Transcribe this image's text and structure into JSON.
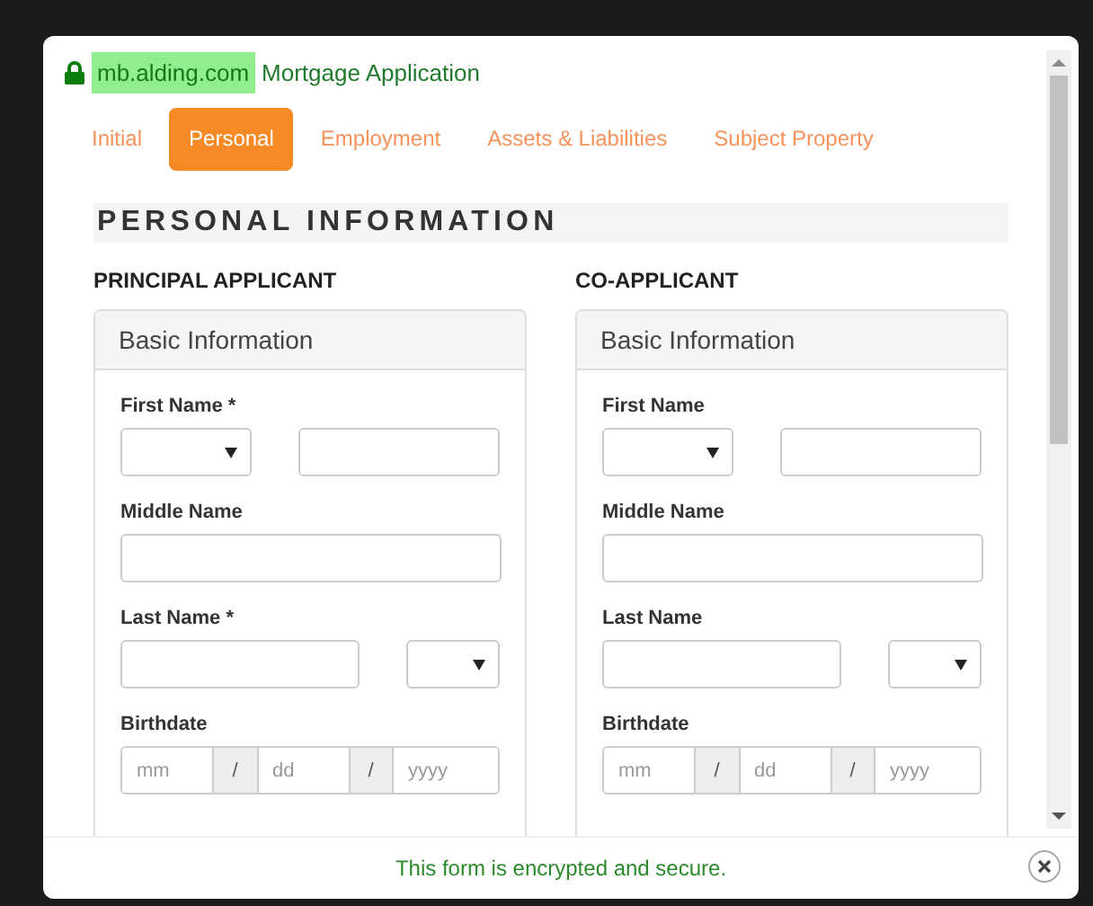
{
  "header": {
    "domain": "mb.alding.com",
    "title": "Mortgage Application"
  },
  "tabs": [
    {
      "label": "Initial",
      "selected": false
    },
    {
      "label": "Personal",
      "selected": true
    },
    {
      "label": "Employment",
      "selected": false
    },
    {
      "label": "Assets & Liabilities",
      "selected": false
    },
    {
      "label": "Subject Property",
      "selected": false
    }
  ],
  "section_title": "PERSONAL INFORMATION",
  "applicants": [
    {
      "heading": "PRINCIPAL APPLICANT",
      "panel_title": "Basic Information",
      "fields": [
        {
          "kind": "prefix-name",
          "label": "First Name *"
        },
        {
          "kind": "text",
          "label": "Middle Name"
        },
        {
          "kind": "name-suffix",
          "label": "Last Name *"
        },
        {
          "kind": "date",
          "label": "Birthdate",
          "placeholders": [
            "mm",
            "dd",
            "yyyy"
          ],
          "separators": [
            "/",
            "/"
          ]
        }
      ]
    },
    {
      "heading": "CO-APPLICANT",
      "panel_title": "Basic Information",
      "fields": [
        {
          "kind": "prefix-name",
          "label": "First Name"
        },
        {
          "kind": "text",
          "label": "Middle Name"
        },
        {
          "kind": "name-suffix",
          "label": "Last Name"
        },
        {
          "kind": "date",
          "label": "Birthdate",
          "placeholders": [
            "mm",
            "dd",
            "yyyy"
          ],
          "separators": [
            "/",
            "/"
          ]
        }
      ]
    }
  ],
  "footer": {
    "message": "This form is encrypted and secure."
  }
}
